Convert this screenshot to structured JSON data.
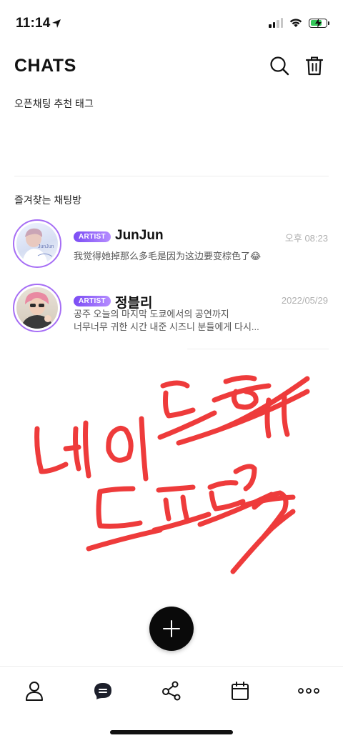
{
  "status_bar": {
    "time": "11:14"
  },
  "header": {
    "title": "CHATS"
  },
  "open_chat": {
    "label": "오픈채팅 추천 태그"
  },
  "favorites": {
    "label": "즐겨찾는 채팅방",
    "rooms": [
      {
        "badge": "ARTIST",
        "name": "JunJun",
        "time": "오후 08:23",
        "preview_lines": [
          "我觉得她掉那么多毛是因为这边要变棕色了😂"
        ],
        "avatar_caption": "JunJun"
      },
      {
        "badge": "ARTIST",
        "name": "정블리",
        "time": "2022/05/29",
        "preview_lines": [
          "공주 오늘의 마지막 도쿄에서의 공연까지",
          "너무너무 귀한 시간 내준 시즈니 분들에게 다시..."
        ]
      }
    ]
  },
  "colors": {
    "accent_purple": "#a66ef5",
    "badge_gradient_start": "#7b4cf4",
    "badge_gradient_end": "#b58cff",
    "scribble_red": "#ee3b3b",
    "fab": "#0a0a0a"
  },
  "icons": {
    "header": [
      "search-icon",
      "trash-icon"
    ],
    "tabs": [
      "person-icon",
      "chat-bubble-icon",
      "share-network-icon",
      "calendar-icon",
      "more-dots-icon"
    ]
  }
}
